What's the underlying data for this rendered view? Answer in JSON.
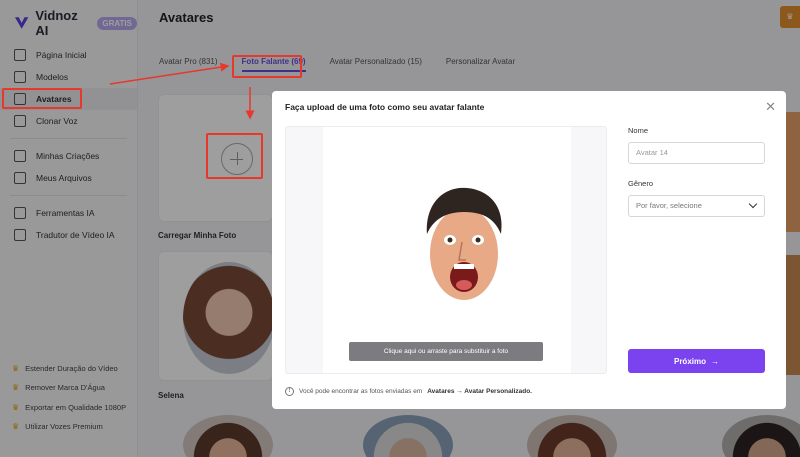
{
  "app": {
    "brand": "Vidnoz AI",
    "badge": "GRATIS",
    "page_title": "Avatares"
  },
  "sidebar": {
    "items": [
      {
        "label": "Página Inicial",
        "icon": "home-icon"
      },
      {
        "label": "Modelos",
        "icon": "template-icon"
      },
      {
        "label": "Avatares",
        "icon": "avatar-icon",
        "active": true
      },
      {
        "label": "Clonar Voz",
        "icon": "voice-icon"
      },
      {
        "label": "Minhas Criações",
        "icon": "play-icon"
      },
      {
        "label": "Meus Arquivos",
        "icon": "cloud-icon"
      },
      {
        "label": "Ferramentas IA",
        "icon": "tools-icon"
      },
      {
        "label": "Tradutor de Vídeo IA",
        "icon": "translate-icon"
      }
    ],
    "perks": [
      "Estender Duração do Vídeo",
      "Remover Marca D'Água",
      "Exportar em Qualidade 1080P",
      "Utilizar Vozes Premium"
    ]
  },
  "tabs": [
    {
      "label": "Avatar Pro (831)"
    },
    {
      "label": "Foto Falante (69)",
      "active": true
    },
    {
      "label": "Avatar Personalizado (15)"
    },
    {
      "label": "Personalizar Avatar"
    }
  ],
  "gallery": {
    "upload_label": "Carregar Minha Foto",
    "first_avatar_name": "Selena"
  },
  "modal": {
    "title": "Faça upload de uma foto como seu avatar falante",
    "replace_text": "Clique aqui ou arraste para substituir a foto",
    "name_label": "Nome",
    "name_placeholder": "Avatar 14",
    "gender_label": "Gênero",
    "gender_placeholder": "Por favor, selecione",
    "next_label": "Próximo",
    "next_arrow": "→",
    "hint_prefix": "Você pode encontrar as fotos enviadas em",
    "hint_path": "Avatares → Avatar Personalizado."
  },
  "colors": {
    "accent": "#7b43f0",
    "annotation": "#e8372b",
    "crown": "#e4a11b"
  }
}
